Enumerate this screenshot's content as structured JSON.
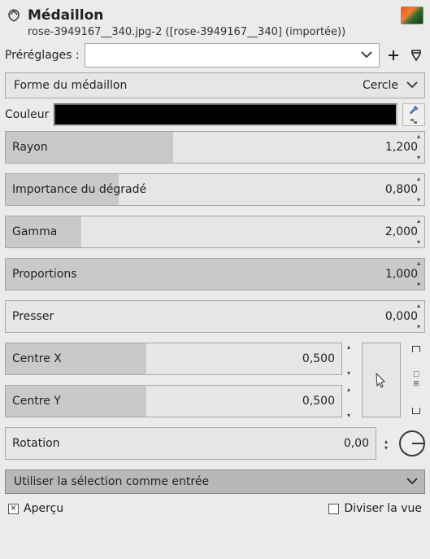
{
  "header": {
    "title": "Médaillon",
    "subtitle": "rose-3949167__340.jpg-2 ([rose-3949167__340] (importée))"
  },
  "presets": {
    "label": "Préréglages :",
    "value": ""
  },
  "shape": {
    "label": "Forme du médaillon",
    "value": "Cercle"
  },
  "color": {
    "label": "Couleur",
    "value": "#000000"
  },
  "sliders": {
    "radius": {
      "label": "Rayon",
      "value": "1,200",
      "fill": 40
    },
    "softness": {
      "label": "Importance du dégradé",
      "value": "0,800",
      "fill": 27
    },
    "gamma": {
      "label": "Gamma",
      "value": "2,000",
      "fill": 18
    },
    "proportion": {
      "label": "Proportions",
      "value": "1,000",
      "fill": 100
    },
    "squeeze": {
      "label": "Presser",
      "value": "0,000",
      "fill": 0
    }
  },
  "center": {
    "x": {
      "label": "Centre X",
      "value": "0,500",
      "fill": 42
    },
    "y": {
      "label": "Centre Y",
      "value": "0,500",
      "fill": 42
    }
  },
  "rotation": {
    "label": "Rotation",
    "value": "0,00",
    "fill": 0
  },
  "selection_input": {
    "label": "Utiliser la sélection comme entrée"
  },
  "footer": {
    "preview": {
      "label": "Aperçu",
      "checked": true
    },
    "split": {
      "label": "Diviser la vue",
      "checked": false
    }
  }
}
